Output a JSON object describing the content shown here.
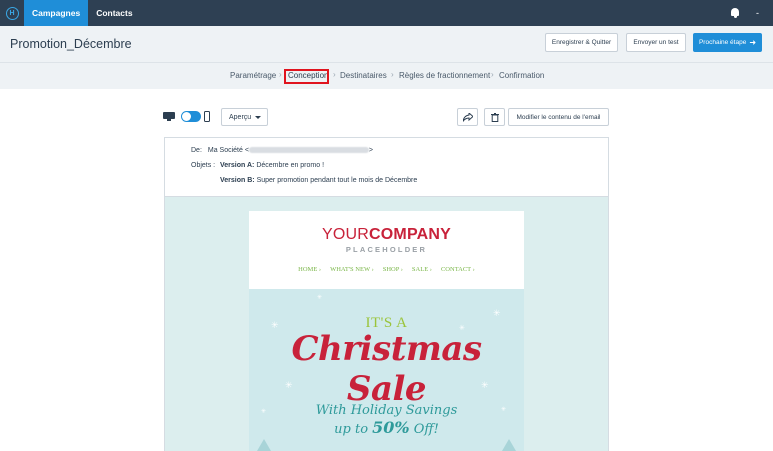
{
  "topnav": {
    "logo": "H",
    "tabs": [
      {
        "label": "Campagnes",
        "active": true
      },
      {
        "label": "Contacts",
        "active": false
      }
    ],
    "user_menu": "-",
    "accent": "#1f8ed8",
    "bg": "#2e4053"
  },
  "header": {
    "title": "Promotion_Décembre",
    "save_quit": "Enregistrer & Quitter",
    "send_test": "Envoyer un test",
    "next_step": "Prochaine étape"
  },
  "stepper": {
    "steps": [
      "Paramétrage",
      "Conception",
      "Destinataires",
      "Règles de fractionnement",
      "Confirmation"
    ],
    "current": "Conception",
    "separator": "›"
  },
  "toolbar": {
    "preview_label": "Aperçu",
    "edit_label": "Modifier le contenu de l'email",
    "share_icon": "share-icon",
    "delete_icon": "trash-icon"
  },
  "meta": {
    "from_label": "De:",
    "from_name": "Ma Société <",
    "from_close": ">",
    "subjects_label": "Objets :",
    "version_a_label": "Version A:",
    "version_a_text": "Décembre en promo !",
    "version_b_label": "Version B:",
    "version_b_text": "Super promotion pendant tout le mois de Décembre"
  },
  "email": {
    "brand_your": "YOUR",
    "brand_company": "COMPANY",
    "brand_sub": "PLACEHOLDER",
    "menu": [
      "HOME ›",
      "WHAT'S NEW ›",
      "SHOP ›",
      "SALE ›",
      "CONTACT ›"
    ],
    "hero_its_a": "IT'S A",
    "hero_title": "Christmas Sale",
    "hero_line1": "With Holiday Savings",
    "hero_line2_pre": "up to ",
    "hero_pct": "50%",
    "hero_line2_post": " Off!",
    "brand_color": "#c8223a",
    "menu_color": "#7ab648"
  }
}
